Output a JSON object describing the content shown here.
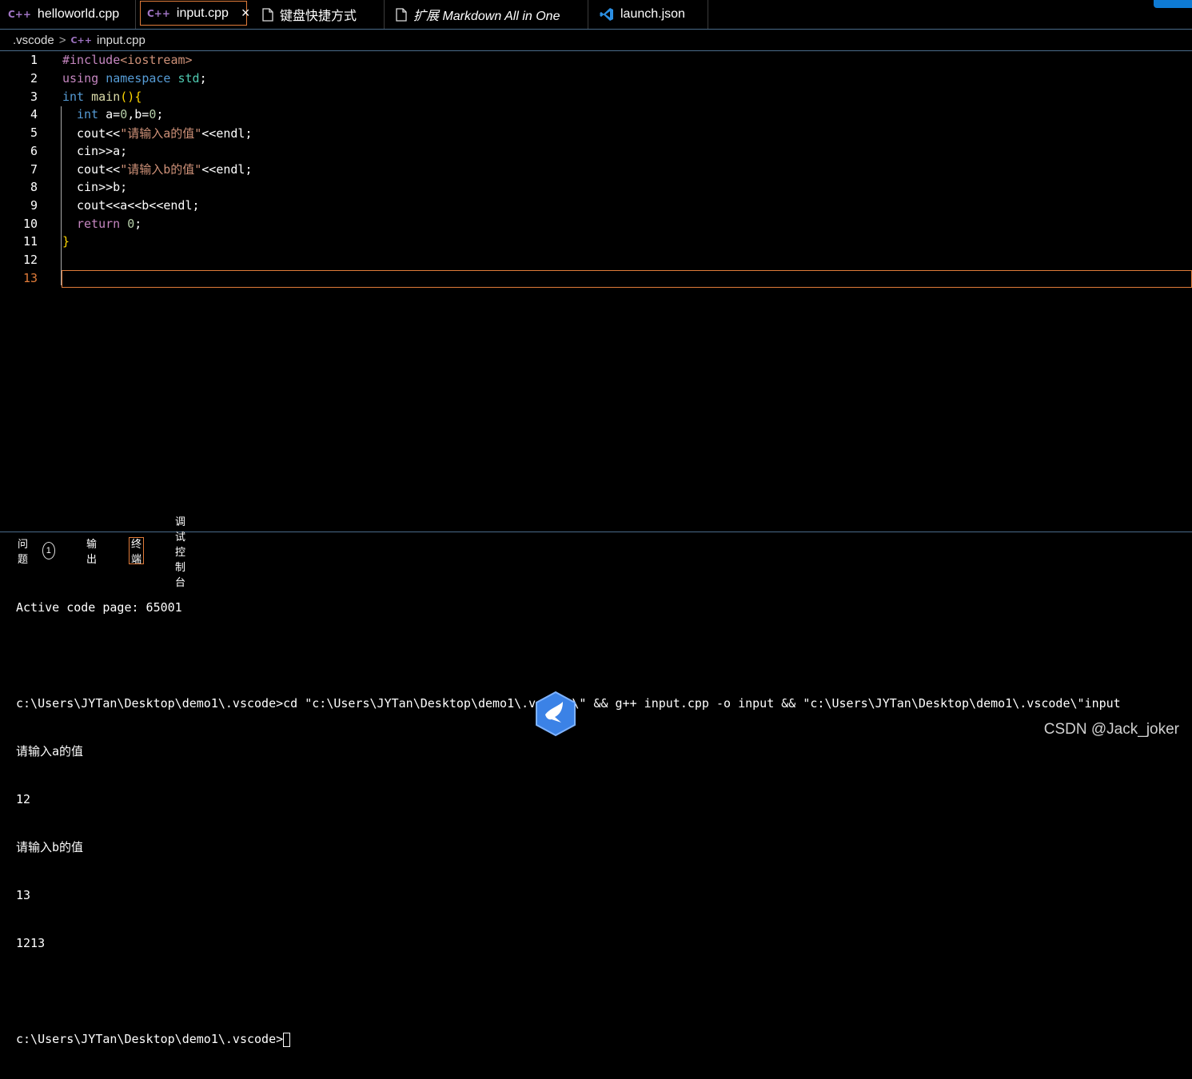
{
  "tabs": [
    {
      "label": "helloworld.cpp",
      "icon": "cpp-icon"
    },
    {
      "label": "input.cpp",
      "icon": "cpp-icon",
      "active": true
    },
    {
      "label": "键盘快捷方式",
      "icon": "file-icon"
    },
    {
      "label": "扩展 Markdown All in One",
      "icon": "file-icon"
    },
    {
      "label": "launch.json",
      "icon": "vscode-icon"
    }
  ],
  "icons": {
    "cpp": "C++",
    "close": "×"
  },
  "breadcrumb": {
    "folder": ".vscode",
    "separator": ">",
    "file": "input.cpp"
  },
  "editor": {
    "line_numbers": [
      "1",
      "2",
      "3",
      "4",
      "5",
      "6",
      "7",
      "8",
      "9",
      "10",
      "11",
      "12",
      "13"
    ],
    "current_line": "13",
    "lines": {
      "l1": {
        "inc": "#include",
        "hdr": "<iostream>"
      },
      "l2": {
        "kw1": "using",
        "kw2": "namespace",
        "ns": "std",
        "semi": ";"
      },
      "l3": {
        "kw": "int",
        "fn": "main",
        "paren": "()",
        "brace": "{"
      },
      "l4": {
        "kw": "int",
        "a": "a=",
        "n1": "0",
        "b": ",b=",
        "n2": "0",
        "semi": ";"
      },
      "l5": {
        "pre": "cout<<",
        "str": "\"请输入a的值\"",
        "post": "<<endl;"
      },
      "l6": {
        "text": "cin>>a;"
      },
      "l7": {
        "pre": "cout<<",
        "str": "\"请输入b的值\"",
        "post": "<<endl;"
      },
      "l8": {
        "text": "cin>>b;"
      },
      "l9": {
        "text": "cout<<a<<b<<endl;"
      },
      "l10": {
        "kw": "return",
        "n": "0",
        "semi": ";"
      },
      "l11": {
        "brace": "}"
      }
    }
  },
  "panel": {
    "tabs": {
      "problems": "问题",
      "problems_count": "1",
      "output": "输出",
      "terminal": "终端",
      "debug_console": "调试控制台"
    },
    "terminal_lines": [
      "Active code page: 65001",
      "",
      "c:\\Users\\JYTan\\Desktop\\demo1\\.vscode>cd \"c:\\Users\\JYTan\\Desktop\\demo1\\.vscode\\\" && g++ input.cpp -o input && \"c:\\Users\\JYTan\\Desktop\\demo1\\.vscode\\\"input",
      "请输入a的值",
      "12",
      "请输入b的值",
      "13",
      "1213",
      ""
    ],
    "prompt": "c:\\Users\\JYTan\\Desktop\\demo1\\.vscode>"
  },
  "watermark": "CSDN @Jack_joker",
  "colors": {
    "accent": "#e07b39",
    "keyword": "#569cd6",
    "control": "#c586c0",
    "string": "#ce9178",
    "type": "#4ec9b0",
    "function": "#dcdcaa",
    "number": "#b5cea8",
    "brace": "#ffd700"
  }
}
